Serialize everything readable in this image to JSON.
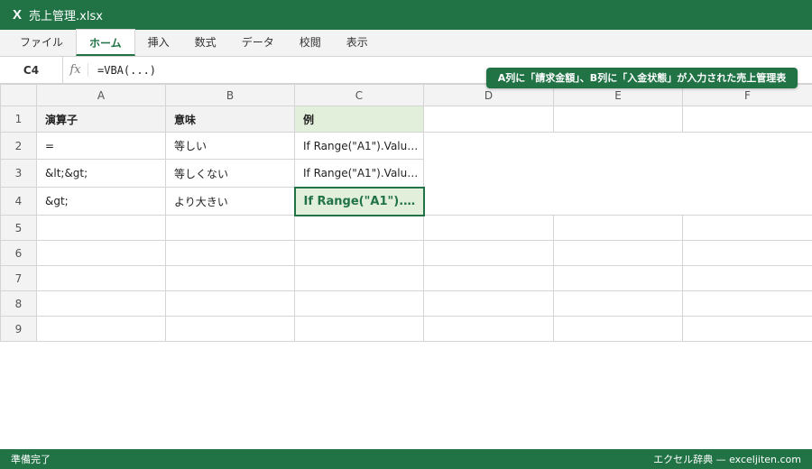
{
  "window": {
    "logo": "X",
    "title": "売上管理.xlsx"
  },
  "ribbon": {
    "tabs": [
      "ファイル",
      "ホーム",
      "挿入",
      "数式",
      "データ",
      "校閲",
      "表示"
    ],
    "active_tab": "ホーム"
  },
  "formula_bar": {
    "name_box": "C4",
    "fx_label": "fx",
    "formula": "=VBA(...)"
  },
  "banner": {
    "text": "A列に「請求金額」、B列に「入金状態」が入力された売上管理表"
  },
  "sheet": {
    "columns": [
      "A",
      "B",
      "C",
      "D",
      "E",
      "F"
    ],
    "rows": [
      {
        "num": "1",
        "A": "演算子",
        "B": "意味",
        "C": "例"
      },
      {
        "num": "2",
        "A": "=",
        "B": "等しい",
        "C": "If Range(\"A1\").Valu…"
      },
      {
        "num": "3",
        "A": "&lt;&gt;",
        "B": "等しくない",
        "C": "If Range(\"A1\").Valu…"
      },
      {
        "num": "4",
        "A": "&gt;",
        "B": "より大きい",
        "C": "If Range(\"A1\").V…"
      },
      {
        "num": "5"
      },
      {
        "num": "6"
      },
      {
        "num": "7"
      },
      {
        "num": "8"
      },
      {
        "num": "9"
      }
    ]
  },
  "status": {
    "left": "準備完了",
    "right": "エクセル辞典 — exceljiten.com"
  },
  "colors": {
    "accent": "#217346",
    "header_fill": "#f2f2f2",
    "selected_fill": "#e2efda",
    "gridline": "#d4d4d4"
  }
}
